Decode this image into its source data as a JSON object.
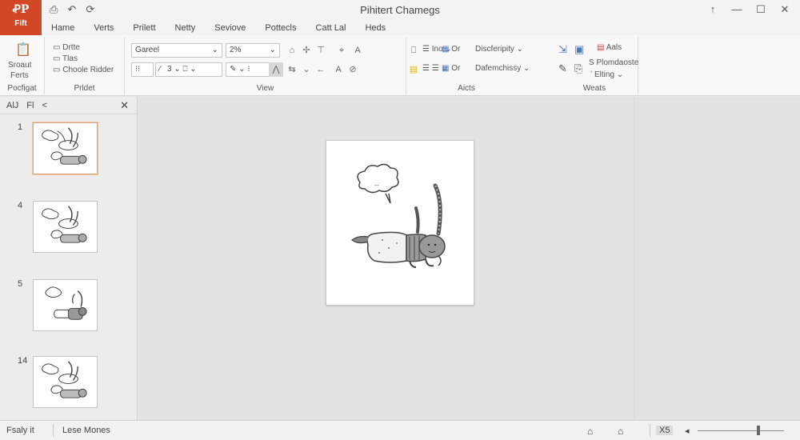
{
  "app": {
    "logo_glyph": "ꝒP",
    "file_tab": "Fift",
    "title": "Pihitert Chamegs",
    "brand_color": "#d24726"
  },
  "quick_access": [
    "⎙",
    "↶",
    "⟳"
  ],
  "window_controls": [
    "↑",
    "—",
    "☐",
    "✕"
  ],
  "tabs": [
    "Hame",
    "Verts",
    "Prilett",
    "Netty",
    "Seviove",
    "Pottecls",
    "Catt Lal",
    "Heds"
  ],
  "ribbon": {
    "clipboard": {
      "big_label_1": "Sroaut",
      "big_label_2": "Ferts",
      "group_label": "Pocfigat"
    },
    "slides": {
      "items": [
        "Drtte",
        "Tlas",
        "Choole Ridder"
      ],
      "group_label": "Prldet"
    },
    "font": {
      "font_name": "Gareel",
      "size_value": "2%",
      "size_num": "3",
      "group_label": "View"
    },
    "paragraph": {
      "line_spacing": "Ino",
      "group_label": "Aicts"
    },
    "arrange": {
      "item1": "Or",
      "item2": "Or",
      "dropdown1": "Discferipity",
      "dropdown2": "Dafemchissy"
    },
    "editing": {
      "find": "Aals",
      "replace": "S Plomdaoste",
      "select": "Elting",
      "group_label": "Weats"
    }
  },
  "left_panel": {
    "header_tabs": [
      "AlJ",
      "Fl",
      "<"
    ],
    "close": "✕",
    "slides": [
      {
        "number": "1",
        "selected": true,
        "variant": "full"
      },
      {
        "number": "4",
        "selected": false,
        "variant": "full"
      },
      {
        "number": "5",
        "selected": false,
        "variant": "single"
      },
      {
        "number": "14",
        "selected": false,
        "variant": "full"
      }
    ]
  },
  "status": {
    "slide_info": "Fsaly it",
    "language": "Lese Mones",
    "zoom_label": "X5",
    "zoom_minus": "◂",
    "zoom_level": 0.68
  }
}
